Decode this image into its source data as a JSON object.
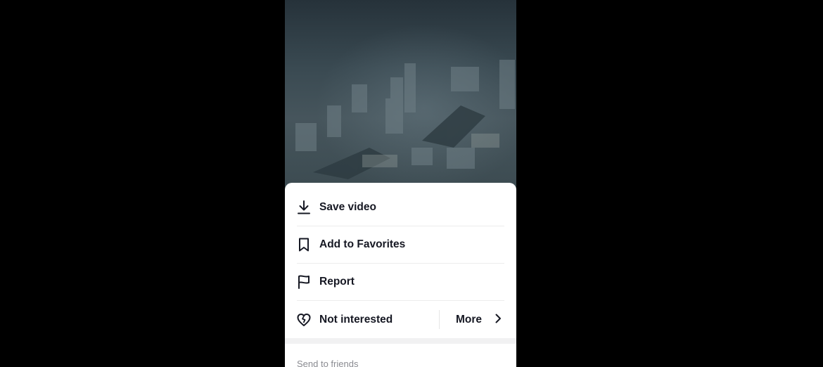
{
  "menu": {
    "items": [
      {
        "label": "Save video",
        "icon": "download-icon"
      },
      {
        "label": "Add to Favorites",
        "icon": "bookmark-icon"
      },
      {
        "label": "Report",
        "icon": "flag-icon"
      },
      {
        "label": "Not interested",
        "icon": "broken-heart-icon"
      }
    ],
    "more_label": "More",
    "section_label": "Send to friends"
  },
  "colors": {
    "text": "#161823",
    "muted": "#8a8b91",
    "background": "#000000"
  }
}
